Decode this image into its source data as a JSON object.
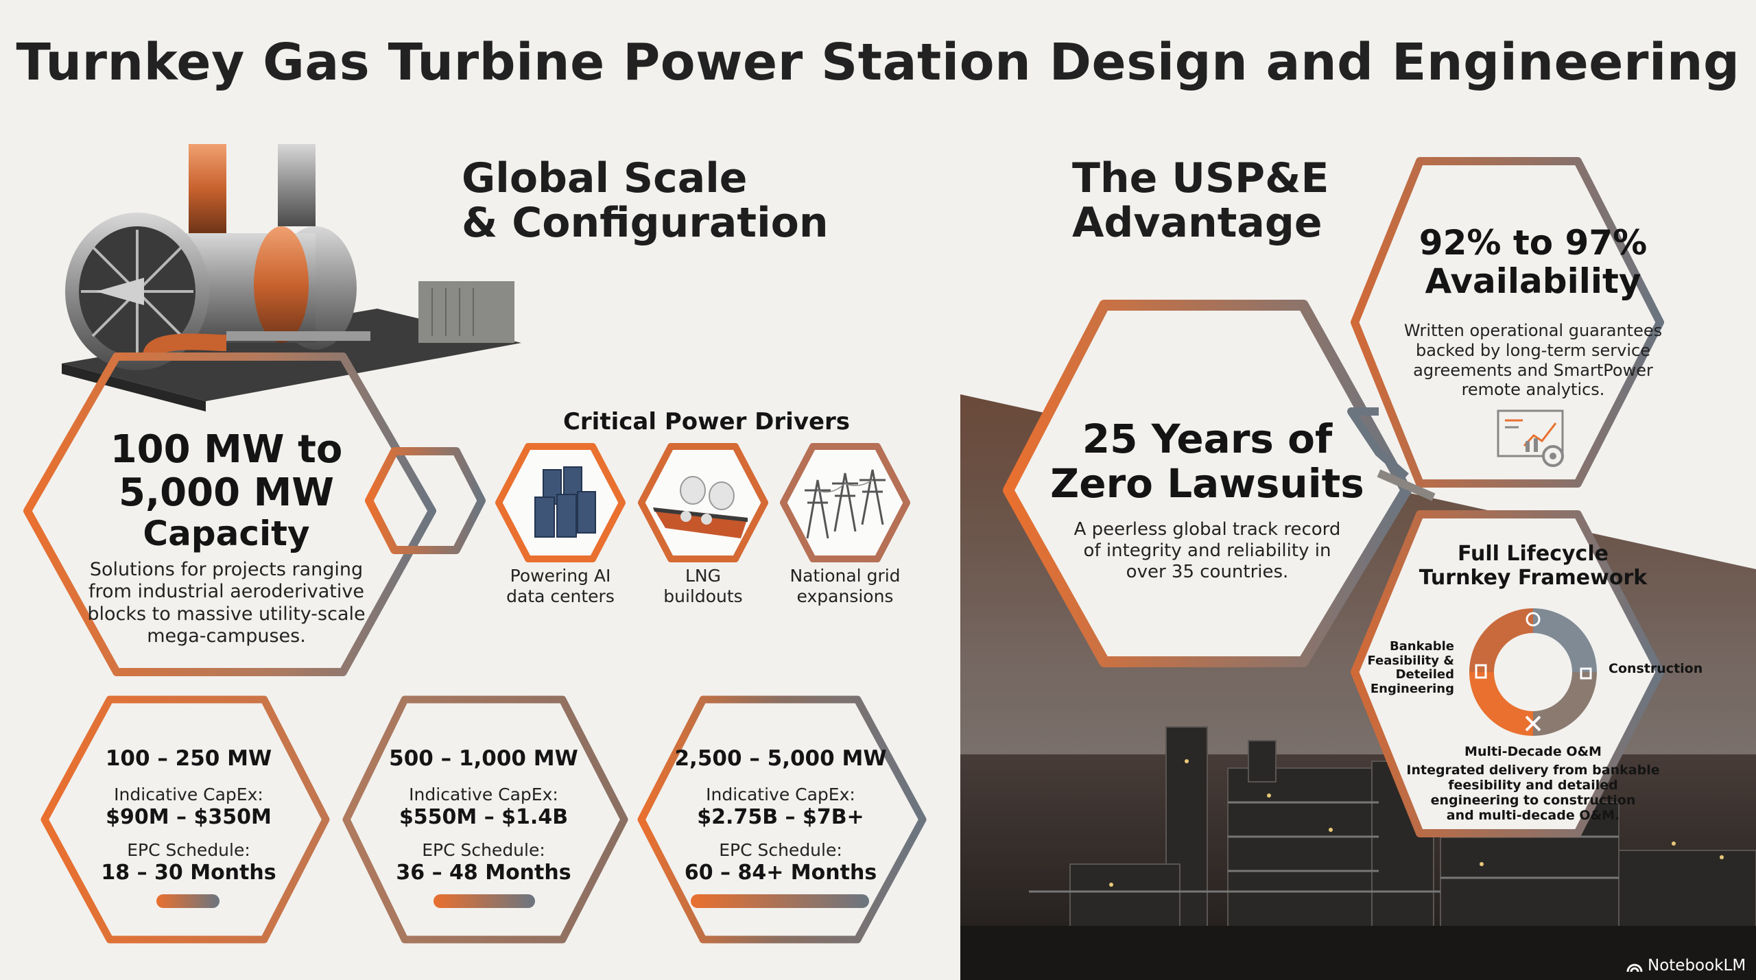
{
  "title": "Turnkey Gas Turbine Power Station Design and Engineering",
  "colors": {
    "accent_orange": "#e9702f",
    "slate": "#6b7580",
    "dark_bg": "#2f2b29",
    "panel_bg": "#f2f1ee"
  },
  "left": {
    "section_title_line1": "Global Scale",
    "section_title_line2": "& Configuration",
    "capacity": {
      "line1": "100 MW to",
      "line2": "5,000 MW",
      "line3": "Capacity",
      "desc_line1": "Solutions for projects ranging",
      "desc_line2": "from industrial aeroderivative",
      "desc_line3": "blocks to massive utility-scale",
      "desc_line4": "mega-campuses."
    },
    "drivers": {
      "title": "Critical Power Drivers",
      "items": [
        {
          "icon": "server-racks-icon",
          "label_line1": "Powering AI",
          "label_line2": "data centers"
        },
        {
          "icon": "lng-tanker-icon",
          "label_line1": "LNG",
          "label_line2": "buildouts"
        },
        {
          "icon": "transmission-towers-icon",
          "label_line1": "National grid",
          "label_line2": "expansions"
        }
      ]
    },
    "tiers": [
      {
        "range": "100 – 250 MW",
        "capex_label": "Indicative CapEx:",
        "capex": "$90M – $350M",
        "schedule_label": "EPC Schedule:",
        "schedule": "18 – 30 Months",
        "bar_fraction": 0.33
      },
      {
        "range": "500 – 1,000 MW",
        "capex_label": "Indicative CapEx:",
        "capex": "$550M – $1.4B",
        "schedule_label": "EPC Schedule:",
        "schedule": "36 – 48 Months",
        "bar_fraction": 0.55
      },
      {
        "range": "2,500 – 5,000 MW",
        "capex_label": "Indicative CapEx:",
        "capex": "$2.75B – $7B+",
        "schedule_label": "EPC Schedule:",
        "schedule": "60 – 84+ Months",
        "bar_fraction": 1.0
      }
    ]
  },
  "right": {
    "section_title_line1": "The USP&E",
    "section_title_line2": "Advantage",
    "availability": {
      "line1": "92% to 97%",
      "line2": "Availability",
      "desc_line1": "Written operational guarantees",
      "desc_line2": "backed by long-term service",
      "desc_line3": "agreements and SmartPower",
      "desc_line4": "remote analytics.",
      "icon": "analytics-dashboard-icon"
    },
    "lawsuits": {
      "line1": "25 Years of",
      "line2": "Zero Lawsuits",
      "desc_line1": "A peerless global track record",
      "desc_line2": "of integrity and reliability in",
      "desc_line3": "over 35 countries."
    },
    "lifecycle": {
      "title_line1": "Full Lifecycle",
      "title_line2": "Turnkey Framework",
      "stage_left_line1": "Bankable",
      "stage_left_line2": "Feasibility &",
      "stage_left_line3": "Deteiled",
      "stage_left_line4": "Engineering",
      "stage_right": "Construction",
      "stage_bottom": "Multi-Decade O&M",
      "desc_line1": "Integrated delivery from bankable",
      "desc_line2": "feesibility and detailed",
      "desc_line3": "engineering to construction",
      "desc_line4": "and multi-decade O&M."
    }
  },
  "watermark": "NotebookLM"
}
